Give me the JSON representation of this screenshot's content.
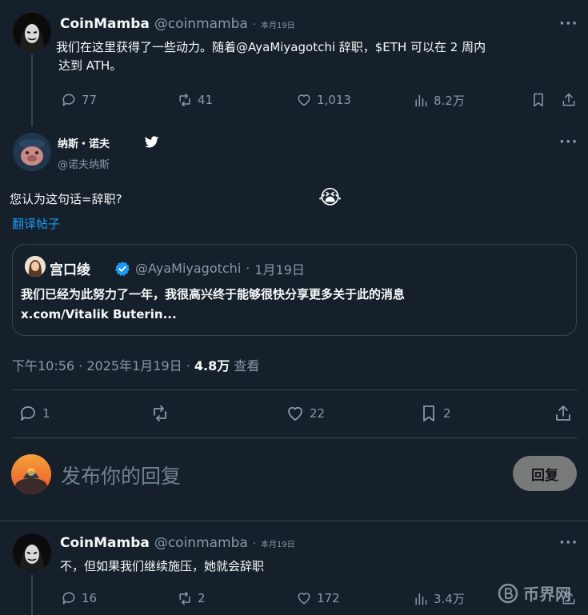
{
  "tweet1": {
    "name": "CoinMamba",
    "handle": "@coinmamba",
    "sep": "·",
    "date": "本月19日",
    "text_line1": "我们在这里获得了一些动力。随着@AyaMiyagotchi 辞职，$ETH 可以在 2 周内",
    "text_line2": "达到 ATH。",
    "replies": "77",
    "retweets": "41",
    "likes": "1,013",
    "views": "8.2万"
  },
  "main_tweet": {
    "name": "纳斯・诺夫",
    "handle": "@诺夫纳斯",
    "text": "您认为这句话=辞职?",
    "emoji": "😭",
    "translate": "翻译帖子",
    "timestamp": "下午10:56 · 2025年1月19日 · ",
    "views_count": "4.8万",
    "views_label": " 查看",
    "replies": "1",
    "likes": "22",
    "bookmarks": "2"
  },
  "quote": {
    "name": "宫口绫",
    "handle": "@AyaMiyagotchi",
    "sep": "·",
    "date": "1月19日",
    "text": "我们已经为此努力了一年，我很高兴终于能够很快分享更多关于此的消息",
    "link": "x.com/Vitalik Buterin..."
  },
  "composer": {
    "placeholder": "发布你的回复",
    "button": "回复"
  },
  "tweet3": {
    "name": "CoinMamba",
    "handle": "@coinmamba",
    "sep": "·",
    "date": "本月19日",
    "text": "不，但如果我们继续施压，她就会辞职",
    "replies": "16",
    "retweets": "2",
    "likes": "172",
    "views": "3.4万"
  },
  "more_label": "···",
  "watermark": "币界网",
  "colors": {
    "background": "#15202b",
    "accent": "#1d9bf0",
    "muted": "#8b98a5",
    "border": "#38444d",
    "verified": "#1d9bf0"
  }
}
